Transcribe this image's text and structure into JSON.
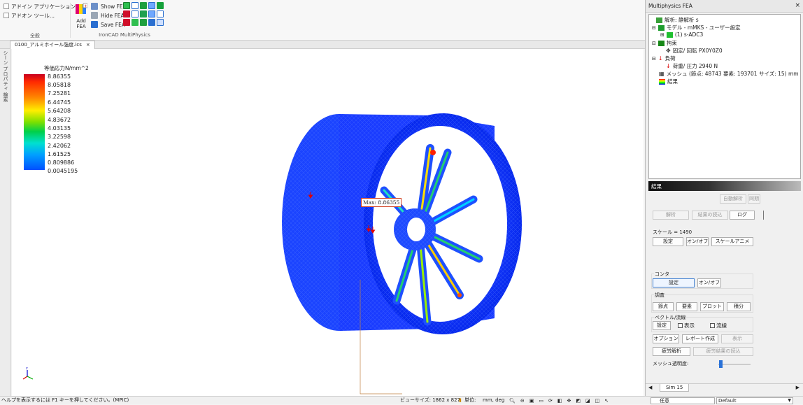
{
  "ribbon": {
    "addin_app": "アドイン アプリケーション...",
    "addin_tool": "アドオン ツール...",
    "group_general": "全般",
    "add_fea_line1": "Add",
    "add_fea_line2": "FEA",
    "show_fea": "Show FEA",
    "hide_fea": "Hide FEA",
    "save_fea": "Save FEA",
    "group_ironcad": "IronCAD MultiPhysics"
  },
  "doc_tab": {
    "label": "0100_アルミホイール強度.ics",
    "close": "×"
  },
  "left_strip": {
    "tab1": "シーン",
    "tab2": "プロパティ",
    "tab3": "検索"
  },
  "legend": {
    "title": "等価応力N/mm^2",
    "values": [
      "8.86355",
      "8.05818",
      "7.25281",
      "6.44745",
      "5.64208",
      "4.83672",
      "4.03135",
      "3.22598",
      "2.42062",
      "1.61525",
      "0.809886",
      "0.0045195"
    ]
  },
  "max_label": "Max: 8.86355",
  "panel": {
    "title": "Multiphysics FEA",
    "tree": {
      "analysis": "解析: 静解析 s",
      "model": "モデル - mMKS - ユーザー設定",
      "part": "(1)  s-ADC3",
      "constraint": "拘束",
      "fix": "固定/ 回転 PX0Y0Z0",
      "load": "負荷",
      "load_item": "荷重/ 圧力 2940 N",
      "mesh": "メッシュ (節点: 48743   要素: 193701  サイズ: 15) mm",
      "result": "結果"
    },
    "results_header": "結果",
    "auto_analysis": "自動解析",
    "sync": "同期",
    "analyze": "解析",
    "load_results": "結果の読込",
    "log": "ログ",
    "scale_text": "スケール = 1490",
    "setting": "設定",
    "onoff": "オン/オフ",
    "scale_anim": "スケールアニメ",
    "contour": "コンタ",
    "contour_setting": "設定",
    "contour_onoff": "オン/オフ",
    "probe": "調査",
    "node": "節点",
    "element": "要素",
    "plot": "プロット",
    "integral": "積分",
    "vector": "ベクトル/流線",
    "vector_setting": "設定",
    "show": "表示",
    "streamline": "流線",
    "option": "オプション",
    "report": "レポート作成",
    "display": "表示",
    "fatigue": "疲労解析",
    "fatigue_load": "疲労結果の読込",
    "mesh_transparency": "メッシュ透明度:",
    "sim_tab": "Sim 15",
    "mesh_transparency_level": 0.02
  },
  "status": {
    "help": "ヘルプを表示するには F1 キーを押してください。(MPIC)",
    "viewsize": "ビューサイズ: 1862 x  827",
    "units_label": "単位:",
    "units": "mm, deg",
    "select_mode": "任意",
    "default": "Default"
  },
  "colors": {
    "accent": "#3f7fd2",
    "mesh_blue": "#1238ff",
    "stress_red": "#ff2000"
  }
}
